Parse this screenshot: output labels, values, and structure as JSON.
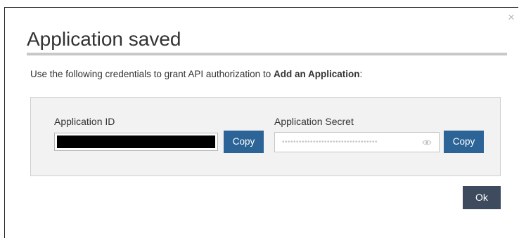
{
  "dialog": {
    "title": "Application saved",
    "close_symbol": "×",
    "instructions": {
      "prefix": "Use the following credentials to grant API authorization to ",
      "app_name": "Add an Application",
      "suffix": ":"
    },
    "credentials": {
      "application_id": {
        "label": "Application ID",
        "value_redacted": true,
        "copy_label": "Copy"
      },
      "application_secret": {
        "label": "Application Secret",
        "masked_value": "••••••••••••••••••••••••••••••••••",
        "reveal_icon": "eye-icon",
        "copy_label": "Copy"
      }
    },
    "ok_label": "Ok"
  },
  "colors": {
    "primary_button": "#2d6497",
    "ok_button": "#3e4b5e",
    "panel_background": "#f2f2f2",
    "title_rule": "#c8c8c8"
  }
}
